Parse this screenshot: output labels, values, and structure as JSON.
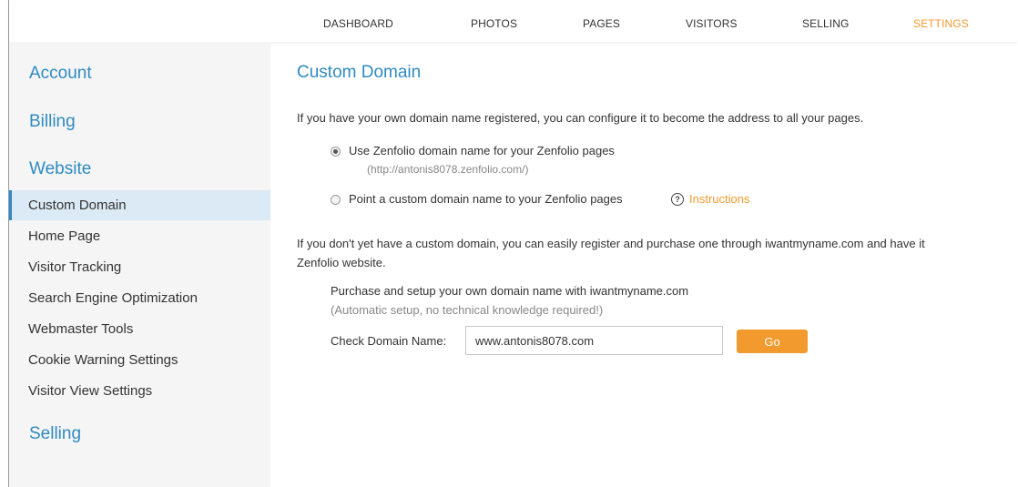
{
  "nav": {
    "items": [
      "DASHBOARD",
      "PHOTOS",
      "PAGES",
      "VISITORS",
      "SELLING",
      "SETTINGS"
    ],
    "active": "SETTINGS",
    "active_color": "#f29a2e"
  },
  "sidebar": {
    "account": "Account",
    "billing": "Billing",
    "website": "Website",
    "items": [
      "Custom Domain",
      "Home Page",
      "Visitor Tracking",
      "Search Engine Optimization",
      "Webmaster Tools",
      "Cookie Warning Settings",
      "Visitor View Settings"
    ],
    "active_item": "Custom Domain",
    "selling": "Selling"
  },
  "main": {
    "title": "Custom Domain",
    "intro": "If you have your own domain name registered, you can configure it to become the address to all your pages.",
    "option_zenfolio": {
      "label": "Use Zenfolio domain name for your Zenfolio pages",
      "url": "(http://antonis8078.zenfolio.com/)",
      "selected": true
    },
    "option_custom": {
      "label": "Point a custom domain name to your Zenfolio pages",
      "help_icon": "?",
      "link": "Instructions",
      "selected": false
    },
    "register_line1": "If you don't yet have a custom domain, you can easily register and purchase one through iwantmyname.com and have it",
    "register_line2": "Zenfolio website.",
    "purchase_title": "Purchase and setup your own domain name with iwantmyname.com",
    "purchase_note": "(Automatic setup, no technical knowledge required!)",
    "check_label": "Check Domain Name:",
    "check_value": "www.antonis8078.com",
    "go_label": "Go"
  },
  "colors": {
    "accent_blue": "#2f8ac1",
    "accent_orange": "#f29a2e",
    "sidebar_bg": "#f5f5f5",
    "active_item_bg": "#dbeaf4"
  }
}
